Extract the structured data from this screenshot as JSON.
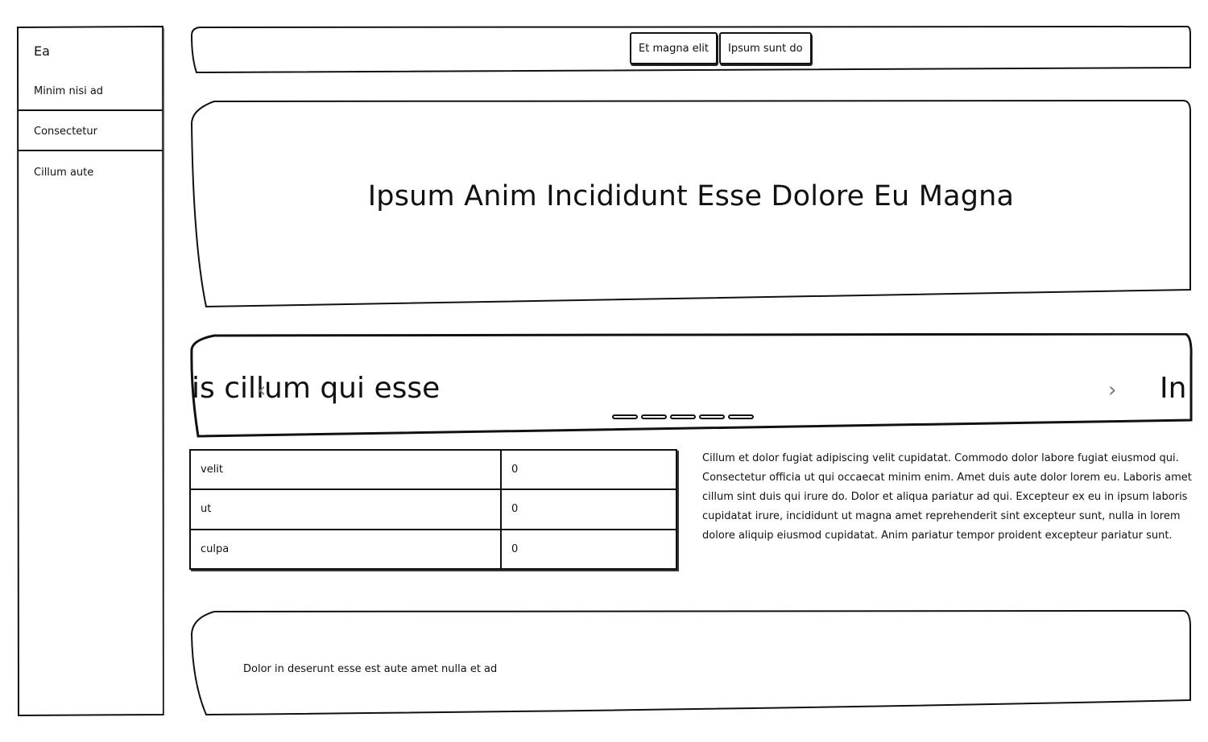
{
  "sidebar": {
    "title": "Ea",
    "items": [
      {
        "label": "Minim nisi ad"
      },
      {
        "label": "Consectetur"
      },
      {
        "label": "Cillum aute"
      }
    ]
  },
  "topbar": {
    "buttons": [
      {
        "label": "Et magna elit"
      },
      {
        "label": "Ipsum sunt do"
      }
    ]
  },
  "hero": {
    "heading": "Ipsum Anim Incididunt Esse Dolore Eu Magna"
  },
  "carousel": {
    "current_slide_text": "is cillum qui esse",
    "next_slide_text": "In",
    "prev_icon": "chevron-left-icon",
    "next_icon": "chevron-right-icon",
    "dot_count": 5
  },
  "table": {
    "rows": [
      {
        "key": "velit",
        "value": "0"
      },
      {
        "key": "ut",
        "value": "0"
      },
      {
        "key": "culpa",
        "value": "0"
      }
    ]
  },
  "paragraph": "Cillum et dolor fugiat adipiscing velit cupidatat. Commodo dolor labore fugiat eiusmod qui. Consectetur officia ut qui occaecat minim enim. Amet duis aute dolor lorem eu. Laboris amet cillum sint duis qui irure do. Dolor et aliqua pariatur ad qui. Excepteur ex eu in ipsum laboris cupidatat irure, incididunt ut magna amet reprehenderit sint excepteur sunt, nulla in lorem dolore aliquip eiusmod cupidatat. Anim pariatur tempor proident excepteur pariatur sunt.",
  "footer": {
    "text": "Dolor in deserunt esse est aute amet nulla et ad"
  }
}
